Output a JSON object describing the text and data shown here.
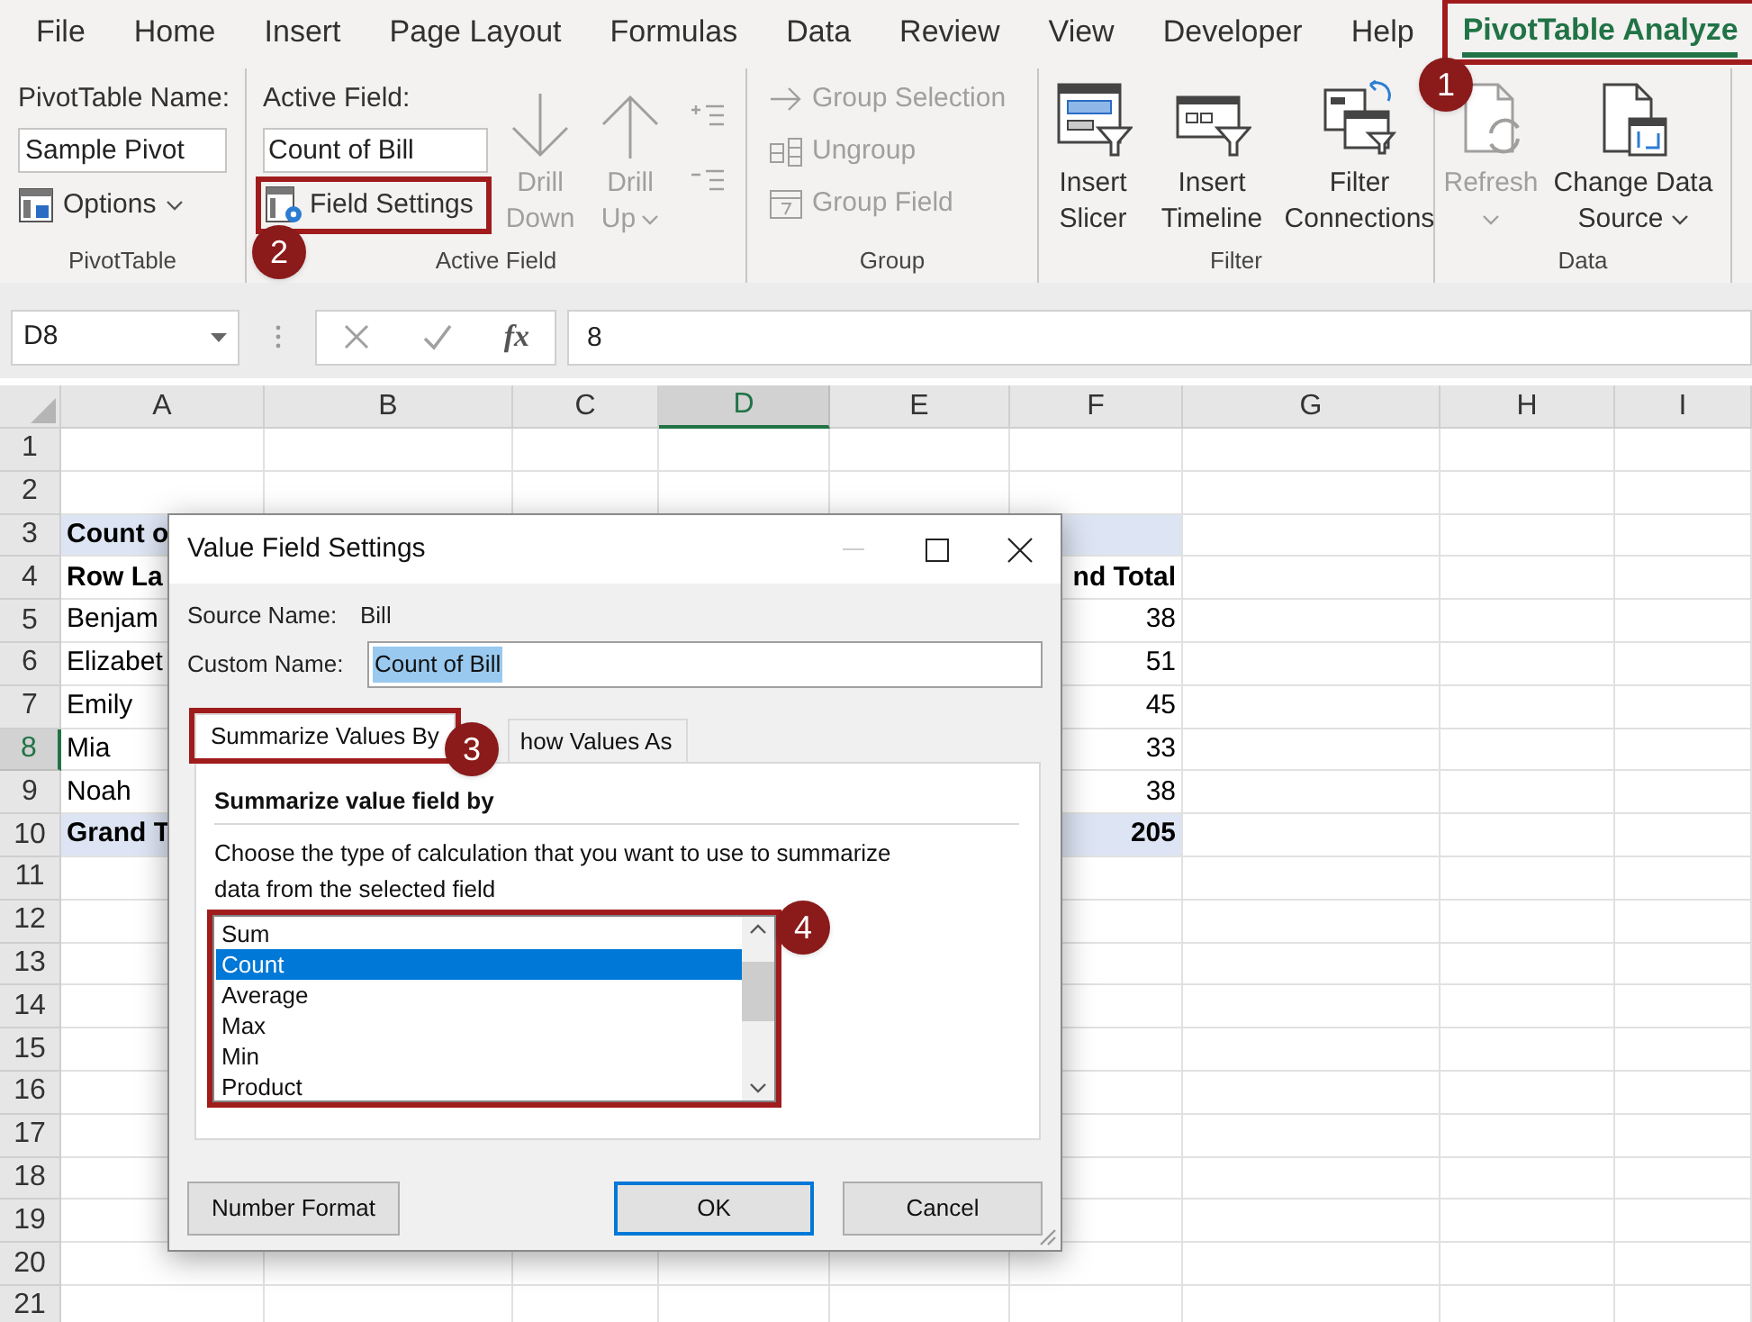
{
  "ribbon_tabs": [
    {
      "label": "File",
      "selected": false
    },
    {
      "label": "Home",
      "selected": false
    },
    {
      "label": "Insert",
      "selected": false
    },
    {
      "label": "Page Layout",
      "selected": false
    },
    {
      "label": "Formulas",
      "selected": false
    },
    {
      "label": "Data",
      "selected": false
    },
    {
      "label": "Review",
      "selected": false
    },
    {
      "label": "View",
      "selected": false
    },
    {
      "label": "Developer",
      "selected": false
    },
    {
      "label": "Help",
      "selected": false
    },
    {
      "label": "PivotTable Analyze",
      "selected": true
    }
  ],
  "ribbon": {
    "pivottable_group": {
      "name_label": "PivotTable Name:",
      "name_value": "Sample Pivot",
      "options_button": "Options",
      "label": "PivotTable"
    },
    "active_field_group": {
      "field_label": "Active Field:",
      "field_value": "Count of Bill",
      "field_settings_button": "Field Settings",
      "drill_buttons": [
        {
          "line1": "Drill",
          "line2": "Down",
          "disabled": true,
          "has_menu": false
        },
        {
          "line1": "Drill",
          "line2": "Up",
          "disabled": true,
          "has_menu": true
        }
      ],
      "label": "Active Field"
    },
    "group_group": {
      "items": [
        {
          "label": "Group Selection",
          "disabled": true
        },
        {
          "label": "Ungroup",
          "disabled": true
        },
        {
          "label": "Group Field",
          "disabled": true
        }
      ],
      "label": "Group"
    },
    "filter_group": {
      "buttons": [
        {
          "line1": "Insert",
          "line2": "Slicer",
          "disabled": false,
          "has_menu": false
        },
        {
          "line1": "Insert",
          "line2": "Timeline",
          "disabled": false,
          "has_menu": false
        },
        {
          "line1": "Filter",
          "line2": "Connections",
          "disabled": false,
          "has_menu": false
        }
      ],
      "label": "Filter"
    },
    "data_group": {
      "buttons": [
        {
          "line1": "Refresh",
          "disabled": true,
          "has_menu": true
        },
        {
          "line1": "Change Data",
          "line2": "Source",
          "disabled": false,
          "has_menu": true
        }
      ],
      "label": "Data"
    }
  },
  "formula_bar": {
    "name_box": "D8",
    "function_label": "fx",
    "formula": "8"
  },
  "sheet": {
    "columns": [
      {
        "label": "A",
        "selected": false
      },
      {
        "label": "B",
        "selected": false
      },
      {
        "label": "C",
        "selected": false
      },
      {
        "label": "D",
        "selected": true
      },
      {
        "label": "E",
        "selected": false
      },
      {
        "label": "F",
        "selected": false
      },
      {
        "label": "G",
        "selected": false
      },
      {
        "label": "H",
        "selected": false
      },
      {
        "label": "I",
        "selected": false
      }
    ],
    "rows": [
      {
        "number": "1",
        "selected": false,
        "kind": "empty"
      },
      {
        "number": "2",
        "selected": false,
        "kind": "empty"
      },
      {
        "number": "3",
        "selected": false,
        "kind": "band",
        "column_a": "Count o"
      },
      {
        "number": "4",
        "selected": false,
        "kind": "heading",
        "column_a": "Row La",
        "column_f": "nd Total"
      },
      {
        "number": "5",
        "selected": false,
        "kind": "item",
        "column_a": "Benjam",
        "column_f": "38"
      },
      {
        "number": "6",
        "selected": false,
        "kind": "item",
        "column_a": "Elizabet",
        "column_f": "51"
      },
      {
        "number": "7",
        "selected": false,
        "kind": "item",
        "column_a": "Emily",
        "column_f": "45"
      },
      {
        "number": "8",
        "selected": true,
        "kind": "item",
        "column_a": "Mia",
        "column_f": "33"
      },
      {
        "number": "9",
        "selected": false,
        "kind": "item",
        "column_a": "Noah",
        "column_f": "38"
      },
      {
        "number": "10",
        "selected": false,
        "kind": "total",
        "column_a": "Grand T",
        "column_f": "205"
      },
      {
        "number": "11",
        "selected": false,
        "kind": "empty"
      },
      {
        "number": "12",
        "selected": false,
        "kind": "empty"
      },
      {
        "number": "13",
        "selected": false,
        "kind": "empty"
      },
      {
        "number": "14",
        "selected": false,
        "kind": "empty"
      },
      {
        "number": "15",
        "selected": false,
        "kind": "empty"
      },
      {
        "number": "16",
        "selected": false,
        "kind": "empty"
      },
      {
        "number": "17",
        "selected": false,
        "kind": "empty"
      },
      {
        "number": "18",
        "selected": false,
        "kind": "empty"
      },
      {
        "number": "19",
        "selected": false,
        "kind": "empty"
      },
      {
        "number": "20",
        "selected": false,
        "kind": "empty"
      },
      {
        "number": "21",
        "selected": false,
        "kind": "empty"
      }
    ]
  },
  "dialog": {
    "title": "Value Field Settings",
    "source_label": "Source Name:",
    "source_value": "Bill",
    "custom_label": "Custom Name:",
    "custom_value": "Count of Bill",
    "tabs": [
      {
        "label": "Summarize Values By",
        "selected": true
      },
      {
        "label": "how Values As",
        "selected": false
      }
    ],
    "heading": "Summarize value field by",
    "description": "Choose the type of calculation that you want to use to summarize data from the selected field",
    "list": [
      {
        "label": "Sum",
        "selected": false
      },
      {
        "label": "Count",
        "selected": true
      },
      {
        "label": "Average",
        "selected": false
      },
      {
        "label": "Max",
        "selected": false
      },
      {
        "label": "Min",
        "selected": false
      },
      {
        "label": "Product",
        "selected": false
      }
    ],
    "buttons": [
      {
        "label": "Number Format",
        "default": false
      },
      {
        "label": "OK",
        "default": true
      },
      {
        "label": "Cancel",
        "default": false
      }
    ]
  },
  "callouts": [
    "1",
    "2",
    "3",
    "4"
  ]
}
